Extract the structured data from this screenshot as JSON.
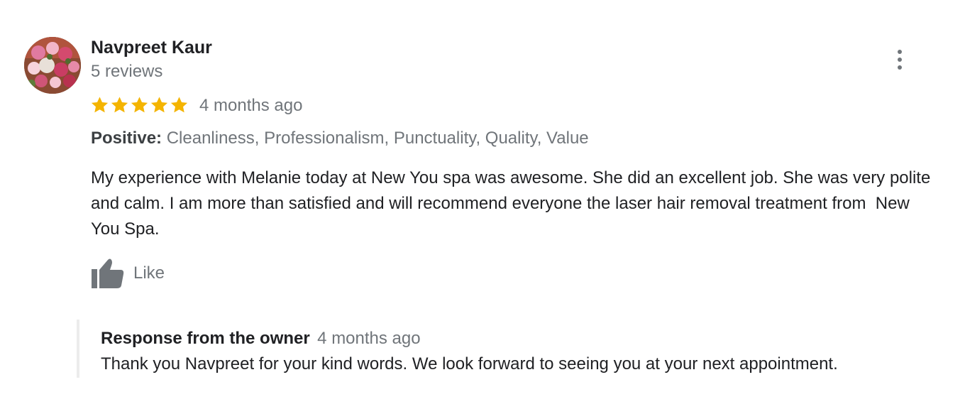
{
  "author": {
    "name": "Navpreet Kaur",
    "reviews_count": "5 reviews",
    "avatar_icon": "flowers-photo"
  },
  "rating": {
    "stars": 5,
    "max_stars": 5,
    "star_color": "#f4b400",
    "time": "4 months ago"
  },
  "positive": {
    "label": "Positive:",
    "values": "Cleanliness, Professionalism, Punctuality, Quality, Value"
  },
  "review_text": "My experience with Melanie today at New You spa was awesome. She did an excellent job. She was very polite and calm. I am more than satisfied and will recommend everyone the laser hair removal treatment from  New You Spa.",
  "actions": {
    "like_label": "Like",
    "like_icon": "thumbs-up-icon",
    "more_icon": "more-vert-icon"
  },
  "owner_response": {
    "title": "Response from the owner",
    "time": "4 months ago",
    "text": "Thank you Navpreet for your kind words. We look forward to seeing you at your next appointment."
  },
  "colors": {
    "primary_text": "#202124",
    "secondary_text": "#70757a",
    "star": "#f4b400",
    "response_border": "#ececec"
  }
}
